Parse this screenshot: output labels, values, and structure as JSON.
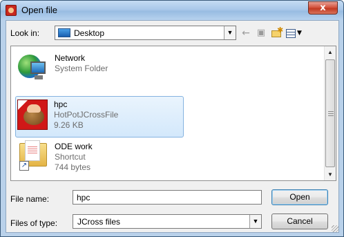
{
  "window": {
    "title": "Open file",
    "close_glyph": "x"
  },
  "toolbar": {
    "lookin_label": "Look in:",
    "lookin_value": "Desktop",
    "lookin_icon": "desktop-icon",
    "tools": [
      "back-arrow-icon",
      "up-folder-icon",
      "new-folder-icon",
      "view-menu-icon"
    ]
  },
  "files": [
    {
      "name": "Network",
      "type": "System Folder",
      "size": "",
      "icon": "network-icon",
      "selected": false
    },
    {
      "name": "hpc",
      "type": "HotPotJCrossFile",
      "size": "9.26 KB",
      "icon": "hotpotatoes-icon",
      "selected": true
    },
    {
      "name": "ODE work",
      "type": "Shortcut",
      "size": "744 bytes",
      "icon": "folder-shortcut-icon",
      "selected": false
    }
  ],
  "form": {
    "filename_label": "File name:",
    "filename_value": "hpc",
    "filetype_label": "Files of type:",
    "filetype_value": "JCross files"
  },
  "buttons": {
    "open_label": "Open",
    "cancel_label": "Cancel"
  },
  "colors": {
    "titlebar": "#a9c8e9",
    "close_button": "#c23a22",
    "selection_border": "#85b3e0"
  }
}
